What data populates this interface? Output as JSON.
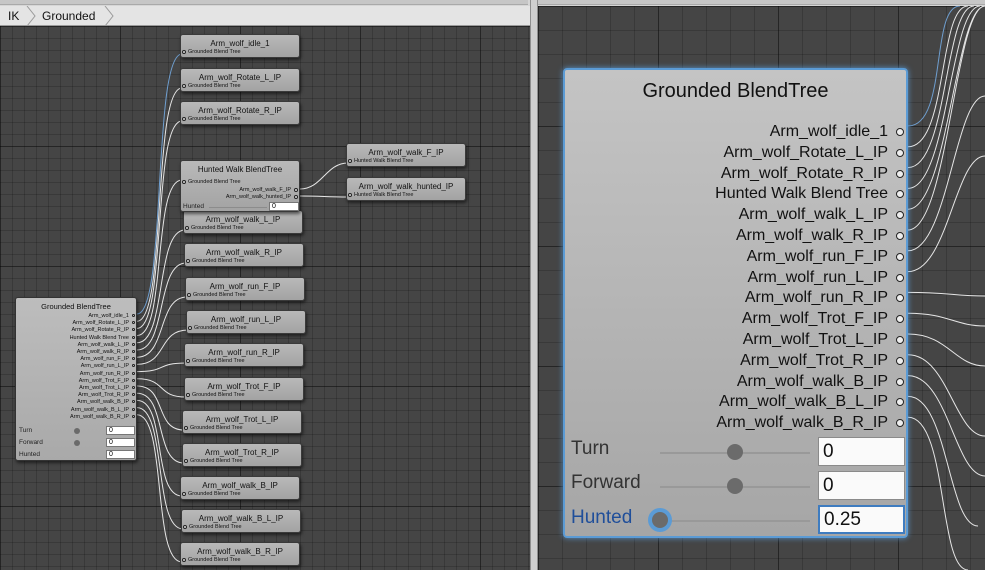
{
  "breadcrumb": [
    "IK",
    "Grounded"
  ],
  "colors": {
    "wire": "#e6e6e6",
    "wire_highlight": "#6f9fd0",
    "selection": "#5b9bd5",
    "active_param": "#1f4e9a"
  },
  "left": {
    "child_nodes": [
      {
        "title": "Arm_wolf_idle_1",
        "subtitle": "Grounded Blend Tree"
      },
      {
        "title": "Arm_wolf_Rotate_L_IP",
        "subtitle": "Grounded Blend Tree"
      },
      {
        "title": "Arm_wolf_Rotate_R_IP",
        "subtitle": "Grounded Blend Tree"
      },
      {
        "title": "Arm_wolf_walk_L_IP",
        "subtitle": "Grounded Blend Tree"
      },
      {
        "title": "Arm_wolf_walk_R_IP",
        "subtitle": "Grounded Blend Tree"
      },
      {
        "title": "Arm_wolf_run_F_IP",
        "subtitle": "Grounded Blend Tree"
      },
      {
        "title": "Arm_wolf_run_L_IP",
        "subtitle": "Grounded Blend Tree"
      },
      {
        "title": "Arm_wolf_run_R_IP",
        "subtitle": "Grounded Blend Tree"
      },
      {
        "title": "Arm_wolf_Trot_F_IP",
        "subtitle": "Grounded Blend Tree"
      },
      {
        "title": "Arm_wolf_Trot_L_IP",
        "subtitle": "Grounded Blend Tree"
      },
      {
        "title": "Arm_wolf_Trot_R_IP",
        "subtitle": "Grounded Blend Tree"
      },
      {
        "title": "Arm_wolf_walk_B_IP",
        "subtitle": "Grounded Blend Tree"
      },
      {
        "title": "Arm_wolf_walk_B_L_IP",
        "subtitle": "Grounded Blend Tree"
      },
      {
        "title": "Arm_wolf_walk_B_R_IP",
        "subtitle": "Grounded Blend Tree"
      }
    ],
    "hunted_node": {
      "title": "Hunted Walk BlendTree",
      "subtitle": "Grounded Blend Tree",
      "outputs": [
        "Arm_wolf_walk_F_IP",
        "Arm_wolf_walk_hunted_IP"
      ],
      "param_label": "Hunted",
      "param_value": "0"
    },
    "hunted_children": [
      {
        "title": "Arm_wolf_walk_F_IP",
        "subtitle": "Hunted Walk Blend Tree"
      },
      {
        "title": "Arm_wolf_walk_hunted_IP",
        "subtitle": "Hunted Walk Blend Tree"
      }
    ],
    "grounded_node": {
      "title": "Grounded BlendTree",
      "params": [
        {
          "label": "Turn",
          "value": "0"
        },
        {
          "label": "Forward",
          "value": "0"
        },
        {
          "label": "Hunted",
          "value": "0"
        }
      ]
    }
  },
  "right": {
    "title": "Grounded BlendTree",
    "outputs": [
      "Arm_wolf_idle_1",
      "Arm_wolf_Rotate_L_IP",
      "Arm_wolf_Rotate_R_IP",
      "Hunted Walk Blend Tree",
      "Arm_wolf_walk_L_IP",
      "Arm_wolf_walk_R_IP",
      "Arm_wolf_run_F_IP",
      "Arm_wolf_run_L_IP",
      "Arm_wolf_run_R_IP",
      "Arm_wolf_Trot_F_IP",
      "Arm_wolf_Trot_L_IP",
      "Arm_wolf_Trot_R_IP",
      "Arm_wolf_walk_B_IP",
      "Arm_wolf_walk_B_L_IP",
      "Arm_wolf_walk_B_R_IP"
    ],
    "params": [
      {
        "label": "Turn",
        "value": "0",
        "level": 0.5
      },
      {
        "label": "Forward",
        "value": "0",
        "level": 0.5
      },
      {
        "label": "Hunted",
        "value": "0.25",
        "level": 0.0,
        "active": true
      }
    ]
  }
}
